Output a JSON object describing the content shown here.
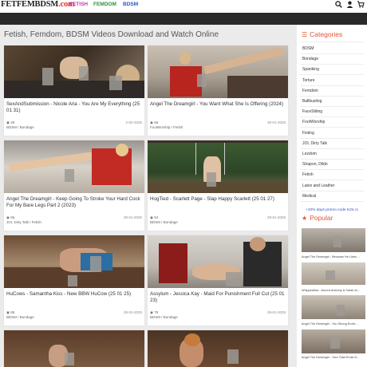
{
  "logo": {
    "part1": "FETFEMBDSM",
    "part2": ".com"
  },
  "nav": {
    "fetish": "FETISH",
    "femdom": "FEMDOM",
    "bdsm": "BDSM"
  },
  "icons": {
    "search": "search-icon",
    "user": "user-icon",
    "cart": "cart-icon"
  },
  "page_title": "Fetish, Femdom, BDSM Videos Download and Watch Online",
  "cards": [
    {
      "title": "SexAndSubmission - Nicole Aria - You Are My Everything (25 01 31)",
      "views": "29",
      "date": "2-02-2025",
      "tags": "BDSM / Bondage"
    },
    {
      "title": "Angel The Dreamgirl - You Want What She Is Offering (2024)",
      "views": "66",
      "date": "30-01-2025",
      "tags": "FootWorship / Fetish"
    },
    {
      "title": "Angel The Dreamgirl - Keep Going To Stroke Your Hard Cock For My Bare Legs Part 2 (2023)",
      "views": "66",
      "date": "30-01-2025",
      "tags": "JOI, Dirty Talk / Fetish"
    },
    {
      "title": "HogTied - Scarlett Page - Slap Happy Scarlett (25 01 27)",
      "views": "54",
      "date": "29-01-2025",
      "tags": "BDSM / Bondage"
    },
    {
      "title": "HuCows - Samantha Kiss - New BBW HuCow (25 01 25)",
      "views": "85",
      "date": "28-01-2025",
      "tags": "BDSM / Bondage"
    },
    {
      "title": "Assylum - Jessica Kay - Maid For Punishment Full Cut (25 01 23)",
      "views": "79",
      "date": "28-01-2025",
      "tags": "BDSM / Bondage"
    }
  ],
  "sidebar": {
    "categories_title": "Categories",
    "categories": [
      "BDSM",
      "Bondage",
      "Spanking",
      "Torture",
      "Femdom",
      "Ballbusting",
      "FaceSitting",
      "FootWorship",
      "Fisting",
      "JOI, Dirty Talk",
      "Lezdom",
      "Strapon, Dildo",
      "Fetish",
      "Latex and Leather",
      "Medical"
    ],
    "promo": "+10% days promo code K2s.cc",
    "popular_title": "Popular",
    "popular": [
      "Angel The Dreamgirl - Because He Likes ...",
      "WhippedAss - Aurora Anarchy & Sarah Ar...",
      "Angel The Dreamgirl - You Strong Erotic ...",
      "Angel The Dreamgirl - Your Total Erotic D..."
    ]
  },
  "colors": {
    "accent": "#e0543a",
    "dark_bar": "#2a2a2a",
    "main_bg": "#ebebeb",
    "link_blue": "#2f4fc9"
  }
}
